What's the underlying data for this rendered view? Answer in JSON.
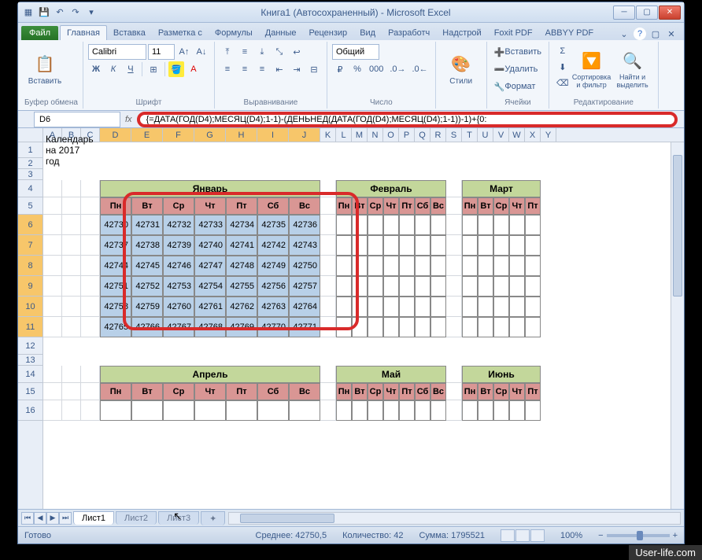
{
  "title": "Книга1 (Автосохраненный) - Microsoft Excel",
  "tabs": {
    "file": "Файл",
    "items": [
      "Главная",
      "Вставка",
      "Разметка с",
      "Формулы",
      "Данные",
      "Рецензир",
      "Вид",
      "Разработч",
      "Надстрой",
      "Foxit PDF",
      "ABBYY PDF"
    ],
    "active": 0
  },
  "ribbon": {
    "clipboard": {
      "label": "Буфер обмена",
      "paste": "Вставить"
    },
    "font": {
      "label": "Шрифт",
      "name": "Calibri",
      "size": "11"
    },
    "alignment": {
      "label": "Выравнивание"
    },
    "number": {
      "label": "Число",
      "format": "Общий"
    },
    "styles": {
      "label": "Стили"
    },
    "cells": {
      "label": "Ячейки",
      "insert": "Вставить",
      "delete": "Удалить",
      "format": "Формат"
    },
    "editing": {
      "label": "Редактирование",
      "sort": "Сортировка и фильтр",
      "find": "Найти и выделить"
    }
  },
  "namebox": "D6",
  "formula": "{=ДАТА(ГОД(D4);МЕСЯЦ(D4);1-1)-(ДЕНЬНЕД(ДАТА(ГОД(D4);МЕСЯЦ(D4);1-1))-1)+{0:",
  "columns": [
    "A",
    "B",
    "C",
    "D",
    "E",
    "F",
    "G",
    "H",
    "I",
    "J",
    "K",
    "L",
    "M",
    "N",
    "O",
    "P",
    "Q",
    "R",
    "S",
    "T",
    "U",
    "V",
    "W",
    "X",
    "Y"
  ],
  "rows": [
    "1",
    "2",
    "3",
    "4",
    "5",
    "6",
    "7",
    "8",
    "9",
    "10",
    "11",
    "12",
    "13",
    "14",
    "15",
    "16"
  ],
  "calendar_title": "Календарь на 2017 год",
  "months": {
    "jan": "Январь",
    "feb": "Февраль",
    "mar": "Март",
    "apr": "Апрель",
    "may": "Май",
    "jun": "Июнь"
  },
  "days": [
    "Пн",
    "Вт",
    "Ср",
    "Чт",
    "Пт",
    "Сб",
    "Вс"
  ],
  "jan_data": [
    [
      42730,
      42731,
      42732,
      42733,
      42734,
      42735,
      42736
    ],
    [
      42737,
      42738,
      42739,
      42740,
      42741,
      42742,
      42743
    ],
    [
      42744,
      42745,
      42746,
      42747,
      42748,
      42749,
      42750
    ],
    [
      42751,
      42752,
      42753,
      42754,
      42755,
      42756,
      42757
    ],
    [
      42758,
      42759,
      42760,
      42761,
      42762,
      42763,
      42764
    ],
    [
      42765,
      42766,
      42767,
      42768,
      42769,
      42770,
      42771
    ]
  ],
  "sheets": [
    "Лист1",
    "Лист2",
    "Лист3"
  ],
  "statusbar": {
    "ready": "Готово",
    "avg": "Среднее: 42750,5",
    "count": "Количество: 42",
    "sum": "Сумма: 1795521",
    "zoom": "100%"
  },
  "watermark": "User-life.com"
}
